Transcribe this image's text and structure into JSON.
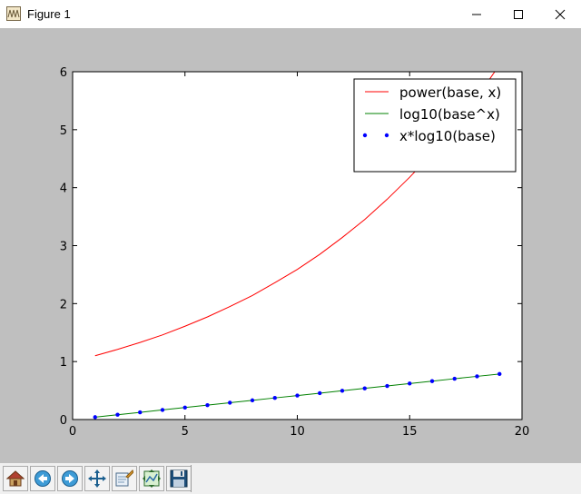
{
  "window": {
    "title": "Figure 1"
  },
  "toolbar": {
    "buttons": [
      {
        "icon": "home-icon"
      },
      {
        "icon": "back-arrow-icon"
      },
      {
        "icon": "forward-arrow-icon"
      },
      {
        "icon": "pan-icon"
      },
      {
        "icon": "zoom-rect-icon"
      },
      {
        "icon": "configure-subplots-icon"
      },
      {
        "icon": "save-icon"
      }
    ]
  },
  "chart_data": {
    "type": "line",
    "title": "",
    "xlabel": "",
    "ylabel": "",
    "xlim": [
      0,
      20
    ],
    "ylim": [
      0,
      6
    ],
    "xticks": [
      0,
      5,
      10,
      15,
      20
    ],
    "yticks": [
      0,
      1,
      2,
      3,
      4,
      5,
      6
    ],
    "grid": false,
    "legend_position": "top-right",
    "x": [
      1,
      2,
      3,
      4,
      5,
      6,
      7,
      8,
      9,
      10,
      11,
      12,
      13,
      14,
      15,
      16,
      17,
      18,
      19
    ],
    "series": [
      {
        "name": "power(base, x)",
        "style": "line",
        "color": "#ff0000",
        "values": [
          1.1,
          1.21,
          1.33,
          1.46,
          1.61,
          1.77,
          1.95,
          2.14,
          2.36,
          2.59,
          2.85,
          3.14,
          3.45,
          3.8,
          4.18,
          4.59,
          5.05,
          5.56,
          6.12
        ]
      },
      {
        "name": "log10(base^x)",
        "style": "line",
        "color": "#008000",
        "values": [
          0.041,
          0.083,
          0.124,
          0.166,
          0.207,
          0.248,
          0.29,
          0.331,
          0.373,
          0.414,
          0.455,
          0.497,
          0.538,
          0.579,
          0.621,
          0.662,
          0.704,
          0.745,
          0.786
        ]
      },
      {
        "name": "x*log10(base)",
        "style": "points",
        "color": "#0000ff",
        "values": [
          0.041,
          0.083,
          0.124,
          0.166,
          0.207,
          0.248,
          0.29,
          0.331,
          0.373,
          0.414,
          0.455,
          0.497,
          0.538,
          0.579,
          0.621,
          0.662,
          0.704,
          0.745,
          0.786
        ]
      }
    ]
  }
}
